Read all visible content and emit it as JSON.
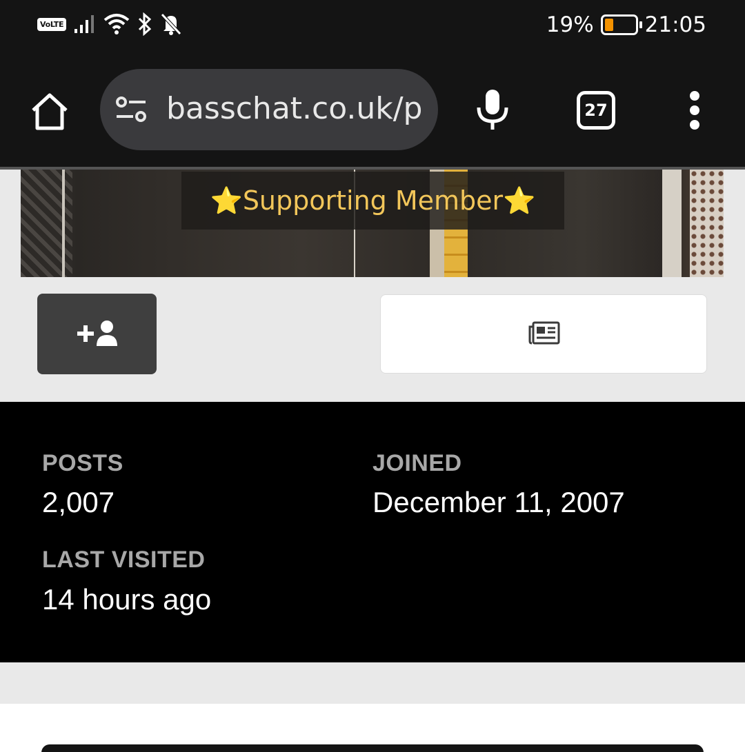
{
  "status_bar": {
    "network_badge": "VoLTE",
    "battery_percent": "19%",
    "battery_level": 0.19,
    "time": "21:05",
    "icons": [
      "signal-icon",
      "wifi-icon",
      "bluetooth-icon",
      "notifications-off-icon"
    ]
  },
  "browser": {
    "url": "basschat.co.uk/pr",
    "tab_count": "27",
    "icons": [
      "home-icon",
      "site-settings-icon",
      "microphone-icon",
      "more-vert-icon"
    ]
  },
  "profile": {
    "badge": "⭐Supporting Member⭐",
    "actions": {
      "follow_icon": "add-user-icon",
      "content_icon": "newspaper-icon"
    },
    "colors": {
      "badge_text": "#f2c65a",
      "battery_fill": "#f39200"
    }
  },
  "stats": {
    "posts_label": "POSTS",
    "posts_value": "2,007",
    "joined_label": "JOINED",
    "joined_value": "December 11, 2007",
    "last_visited_label": "LAST VISITED",
    "last_visited_value": "14 hours ago"
  }
}
